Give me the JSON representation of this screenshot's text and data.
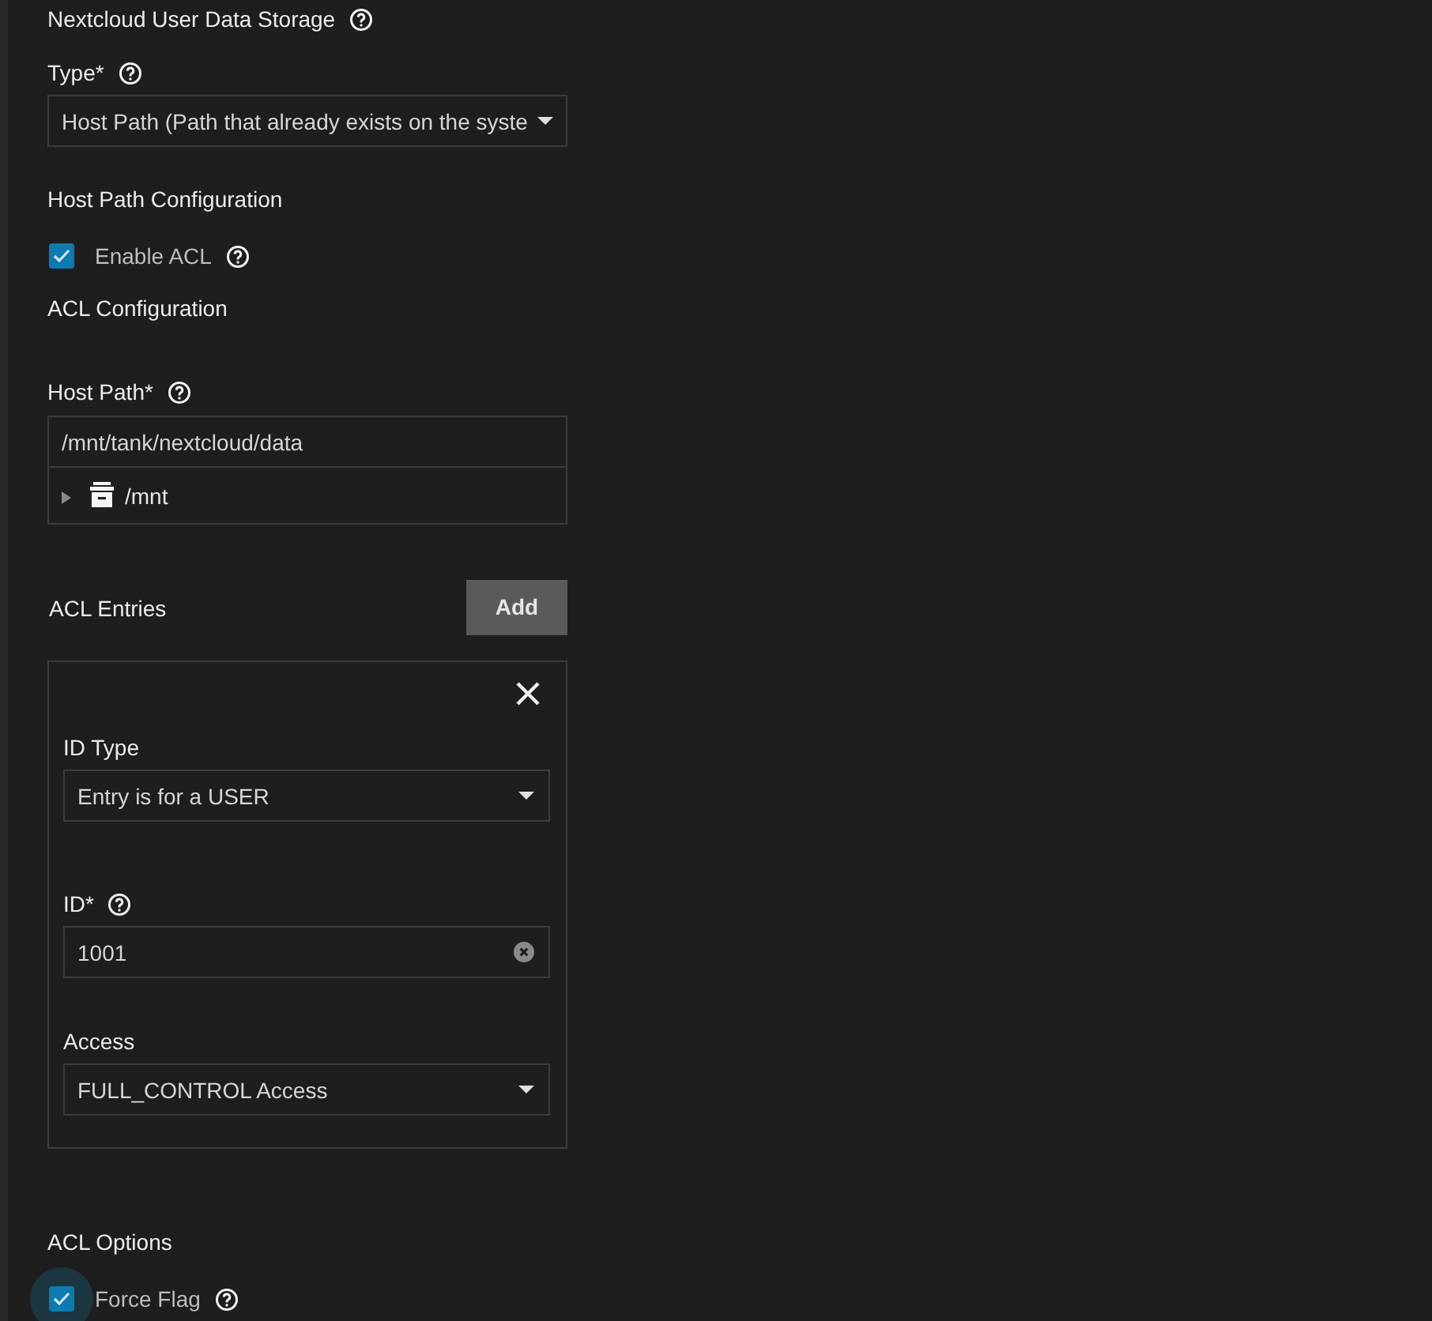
{
  "storage": {
    "title": "Nextcloud User Data Storage",
    "help": true
  },
  "type_field": {
    "label": "Type*",
    "help": true,
    "value": "Host Path (Path that already exists on the syste"
  },
  "host_path_config": {
    "title": "Host Path Configuration"
  },
  "enable_acl": {
    "label": "Enable ACL",
    "help": true,
    "checked": true
  },
  "acl_config": {
    "title": "ACL Configuration"
  },
  "host_path": {
    "label": "Host Path*",
    "help": true,
    "value": "/mnt/tank/nextcloud/data",
    "tree": [
      {
        "label": "/mnt",
        "expanded": false
      }
    ]
  },
  "acl_entries": {
    "title": "ACL Entries",
    "add_button": "Add",
    "entries": [
      {
        "id_type": {
          "label": "ID Type",
          "help": false,
          "value": "Entry is for a USER"
        },
        "id": {
          "label": "ID*",
          "help": true,
          "value": "1001"
        },
        "access": {
          "label": "Access",
          "help": false,
          "value": "FULL_CONTROL Access"
        }
      }
    ]
  },
  "acl_options": {
    "title": "ACL Options",
    "force_flag": {
      "label": "Force Flag",
      "help": true,
      "checked": true,
      "focused": true
    }
  }
}
